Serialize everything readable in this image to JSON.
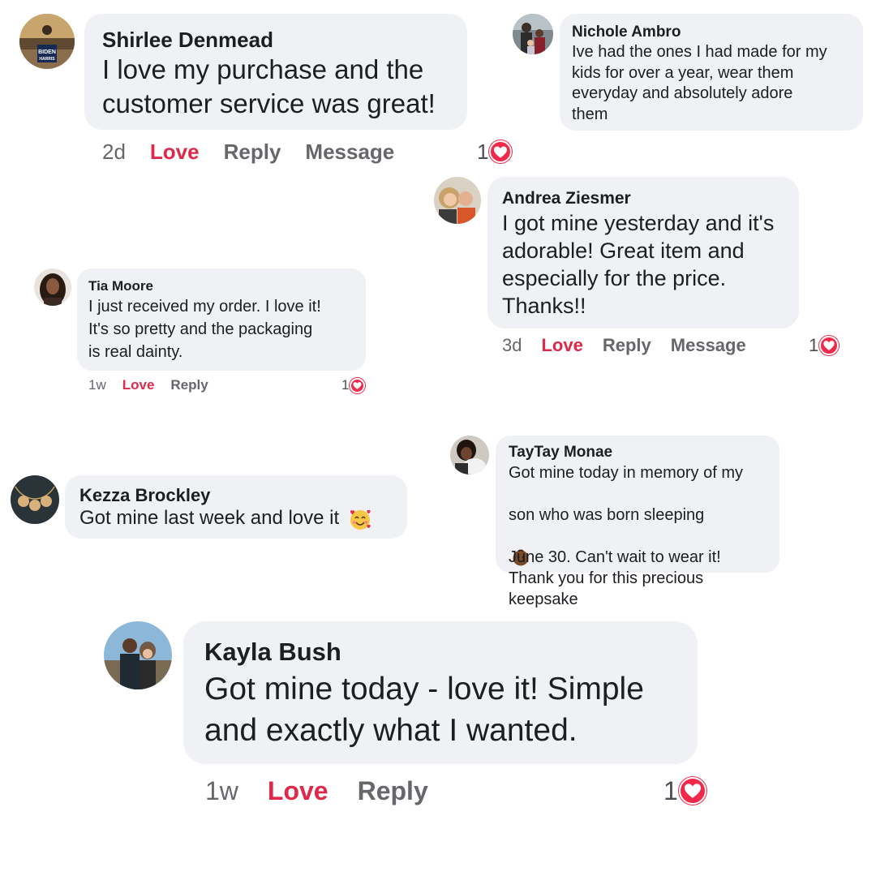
{
  "comments": [
    {
      "name": "Shirlee Denmead",
      "text": "I love my purchase and the\ncustomer service was great!",
      "time": "2d",
      "love": "Love",
      "reply": "Reply",
      "message": "Message",
      "reactions": "1",
      "avatar_text_top": "BIDEN",
      "avatar_text_bottom": "HARRIS"
    },
    {
      "name": "Nichole Ambro",
      "text": "Ive had the ones I had made for my\nkids for over a year, wear them\neveryday and absolutely adore\nthem"
    },
    {
      "name": "Andrea Ziesmer",
      "text": "I got mine yesterday and it's\nadorable! Great item and\nespecially for the price.\nThanks!!",
      "time": "3d",
      "love": "Love",
      "reply": "Reply",
      "message": "Message",
      "reactions": "1"
    },
    {
      "name": "Tia Moore",
      "text": "I just received my order. I love it!\nIt's so pretty and the packaging\nis real dainty.",
      "time": "1w",
      "love": "Love",
      "reply": "Reply",
      "reactions": "1"
    },
    {
      "name": "Kezza Brockley",
      "text": "Got mine last week and love it",
      "emoji": "smiling-face-with-hearts"
    },
    {
      "name": "TayTay Monae",
      "text_line1": "Got mine today in memory of my",
      "text_line2": "son who was born sleeping",
      "text_rest": "June 30. Can't wait to wear it!\nThank you for this precious\nkeepsake",
      "emoji": "baby-emoji"
    },
    {
      "name": "Kayla Bush",
      "text": "Got mine today - love it! Simple\nand exactly what I wanted.",
      "time": "1w",
      "love": "Love",
      "reply": "Reply",
      "reactions": "1"
    }
  ],
  "colors": {
    "bubble": "#eff1f4",
    "love": "#e0294a",
    "heart": "#f0284a",
    "meta": "#65676b"
  }
}
